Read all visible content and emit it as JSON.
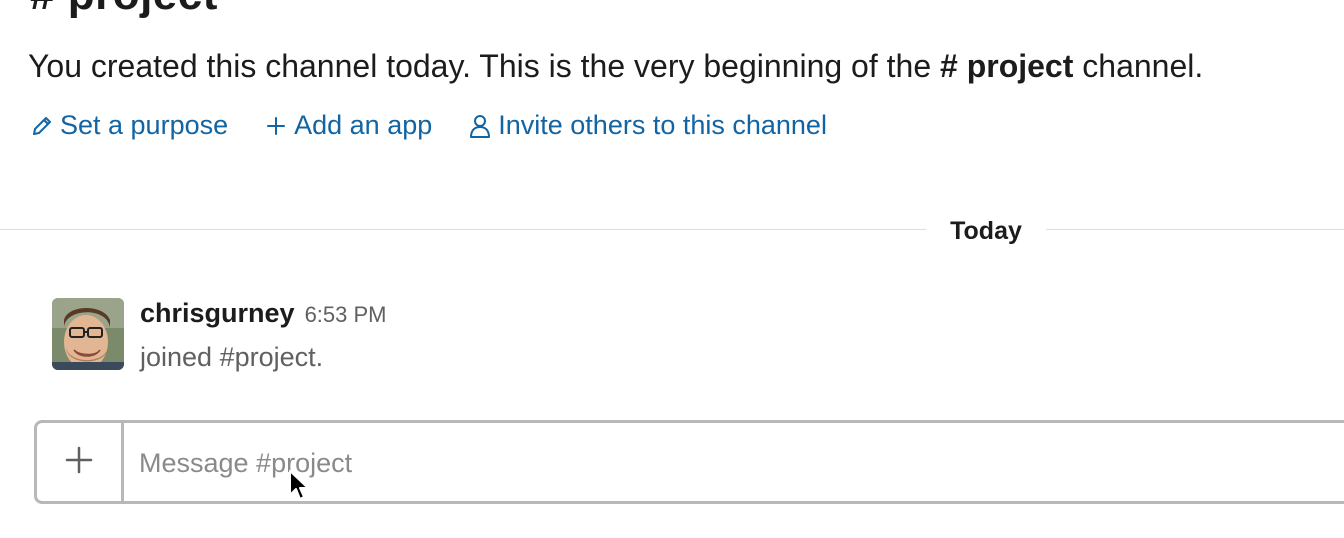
{
  "channel": {
    "title": "# project"
  },
  "intro": {
    "text_before": "You created this channel today. This is the very beginning of the ",
    "channel_hash": "#",
    "channel_name": "project",
    "text_after": " channel."
  },
  "actions": [
    {
      "icon": "pencil-icon",
      "label": "Set a purpose"
    },
    {
      "icon": "plus-icon",
      "label": "Add an app"
    },
    {
      "icon": "person-icon",
      "label": "Invite others to this channel"
    }
  ],
  "divider": {
    "label": "Today"
  },
  "message": {
    "username": "chrisgurney",
    "timestamp": "6:53 PM",
    "text": "joined #project."
  },
  "composer": {
    "placeholder": "Message #project",
    "value": ""
  },
  "colors": {
    "link": "#1264a3",
    "text": "#1d1c1d",
    "muted": "#616061",
    "border": "#b8b8b8"
  }
}
